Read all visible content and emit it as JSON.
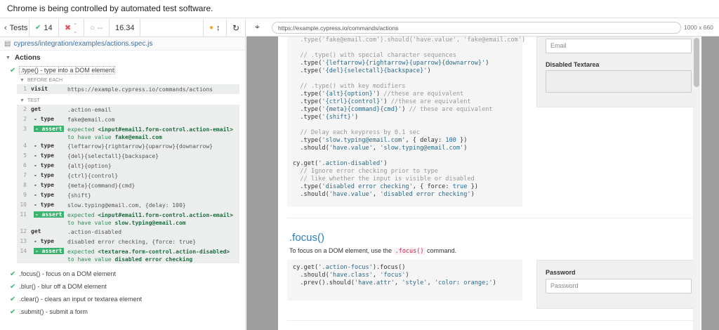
{
  "banner": {
    "text": "Chrome is being controlled by automated test software."
  },
  "stats": {
    "tests_label": "Tests",
    "passed": "14",
    "failed": "--",
    "pending": "--",
    "duration": "16.34"
  },
  "spec": {
    "path": "cypress/integration/examples/actions.spec.js"
  },
  "suite": {
    "title": "Actions"
  },
  "active_test": {
    "title": ".type() - type into a DOM element",
    "before_each_label": "BEFORE EACH",
    "test_label": "TEST",
    "before_each": [
      {
        "num": "1",
        "name": "visit",
        "msg": "https://example.cypress.io/commands/actions"
      }
    ],
    "commands": [
      {
        "num": "2",
        "name": "get",
        "msg": ".action-email",
        "type": "plain"
      },
      {
        "num": "2",
        "name": "- type",
        "msg": "fake@email.com",
        "type": "sub"
      },
      {
        "num": "3",
        "name": "- assert",
        "msg1": "expected ",
        "strong1": "<input#email1.form-control.action-email>",
        "msg2": " to have value ",
        "strong2": "fake@email.com",
        "type": "assert"
      },
      {
        "num": "4",
        "name": "- type",
        "msg": "{leftarrow}{rightarrow}{uparrow}{downarrow}",
        "type": "sub"
      },
      {
        "num": "5",
        "name": "- type",
        "msg": "{del}{selectall}{backspace}",
        "type": "sub"
      },
      {
        "num": "6",
        "name": "- type",
        "msg": "{alt}{option}",
        "type": "sub"
      },
      {
        "num": "7",
        "name": "- type",
        "msg": "{ctrl}{control}",
        "type": "sub"
      },
      {
        "num": "8",
        "name": "- type",
        "msg": "{meta}{command}{cmd}",
        "type": "sub"
      },
      {
        "num": "9",
        "name": "- type",
        "msg": "{shift}",
        "type": "sub"
      },
      {
        "num": "10",
        "name": "- type",
        "msg": "slow.typing@email.com, {delay: 100}",
        "type": "sub"
      },
      {
        "num": "11",
        "name": "- assert",
        "msg1": "expected ",
        "strong1": "<input#email1.form-control.action-email>",
        "msg2": " to have value ",
        "strong2": "slow.typing@email.com",
        "type": "assert"
      },
      {
        "num": "12",
        "name": "get",
        "msg": ".action-disabled",
        "type": "plain"
      },
      {
        "num": "13",
        "name": "- type",
        "msg": "disabled error checking, {force: true}",
        "type": "sub"
      },
      {
        "num": "14",
        "name": "- assert",
        "msg1": "expected ",
        "strong1": "<textarea.form-control.action-disabled>",
        "msg2": " to have value ",
        "strong2": "disabled error checking",
        "type": "assert"
      }
    ]
  },
  "other_tests": [
    ".focus() - focus on a DOM element",
    ".blur() - blur off a DOM element",
    ".clear() - clears an input or textarea element",
    ".submit() - submit a form"
  ],
  "browser": {
    "url": "https://example.cypress.io/commands/actions",
    "viewport": "1000 x 660"
  },
  "aut": {
    "email_placeholder": "Email",
    "disabled_textarea_label": "Disabled Textarea",
    "focus_heading": ".focus()",
    "focus_desc_pre": "To focus on a DOM element, use the ",
    "focus_desc_code": ".focus()",
    "focus_desc_post": " command.",
    "password_label": "Password",
    "password_placeholder": "Password"
  },
  "colors": {
    "pass": "#3cb371",
    "link": "#2b7fc2",
    "aut_bg": "#9e9e9e"
  }
}
